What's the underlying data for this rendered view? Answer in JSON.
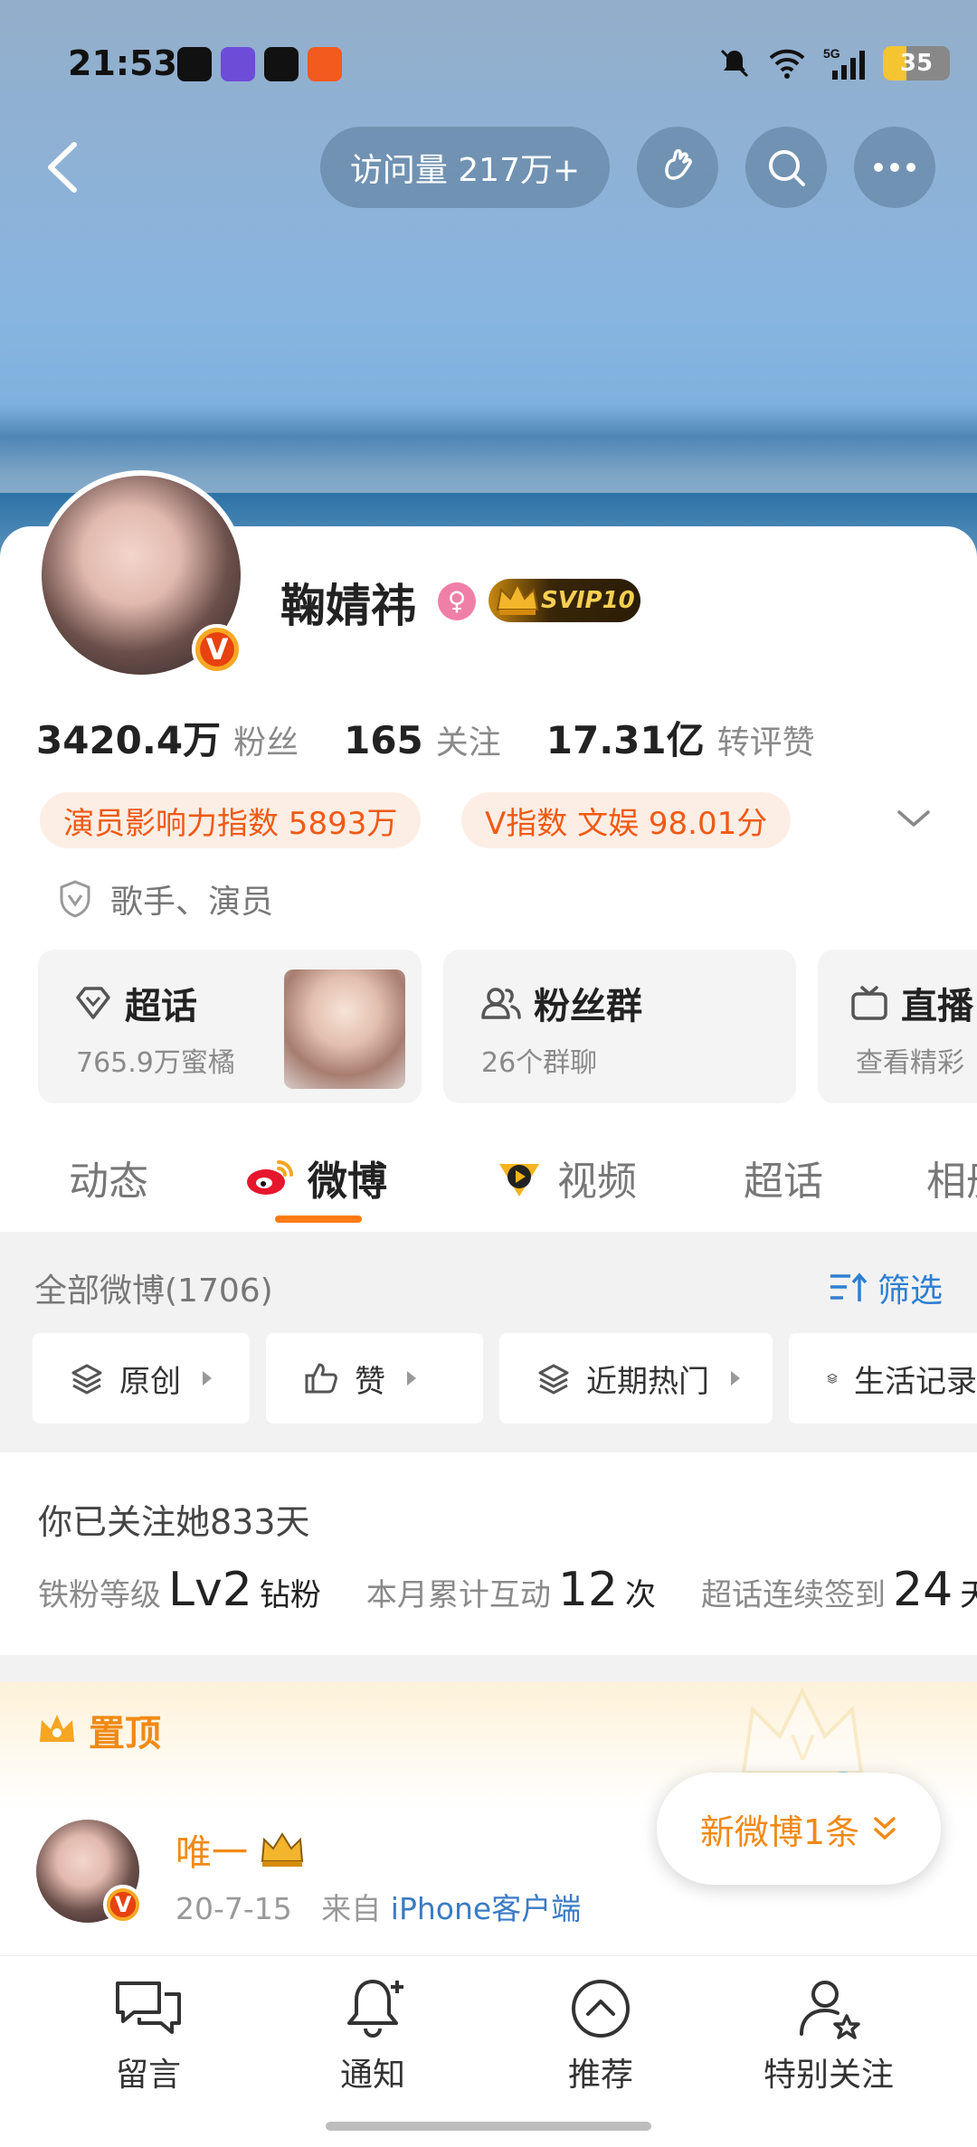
{
  "status_bar": {
    "time": "21:53",
    "battery": "35",
    "network": "5G"
  },
  "header": {
    "visits": "访问量 217万+"
  },
  "profile": {
    "name": "鞠婧祎",
    "vip_badge": "SVIP10",
    "stats": [
      {
        "value": "3420.4万",
        "label": "粉丝"
      },
      {
        "value": "165",
        "label": "关注"
      },
      {
        "value": "17.31亿",
        "label": "转评赞"
      }
    ],
    "tags": [
      "演员影响力指数 5893万",
      "V指数 文娱 98.01分"
    ],
    "role": "歌手、演员"
  },
  "features": [
    {
      "title": "超话",
      "sub": "765.9万蜜橘"
    },
    {
      "title": "粉丝群",
      "sub": "26个群聊"
    },
    {
      "title": "直播",
      "sub": "查看精彩"
    }
  ],
  "tabs": [
    "动态",
    "微博",
    "视频",
    "超话",
    "相册"
  ],
  "weibo_list": {
    "all_label": "全部微博(1706)",
    "filter_label": "筛选",
    "chips": [
      "原创",
      "赞",
      "近期热门",
      "生活记录"
    ]
  },
  "fan_info": {
    "follow_days": "你已关注她833天",
    "level_label": "铁粉等级",
    "level_value": "Lv2",
    "level_type": "钻粉",
    "interact_label": "本月累计互动",
    "interact_value": "12",
    "interact_unit": "次",
    "checkin_label": "超话连续签到",
    "checkin_value": "24",
    "checkin_unit": "天"
  },
  "pinned": {
    "label": "置顶",
    "author": "唯一",
    "date": "20-7-15",
    "from_prefix": "来自",
    "source": "iPhone客户端"
  },
  "new_posts": "新微博1条",
  "bottom_nav": [
    "留言",
    "通知",
    "推荐",
    "特别关注"
  ]
}
